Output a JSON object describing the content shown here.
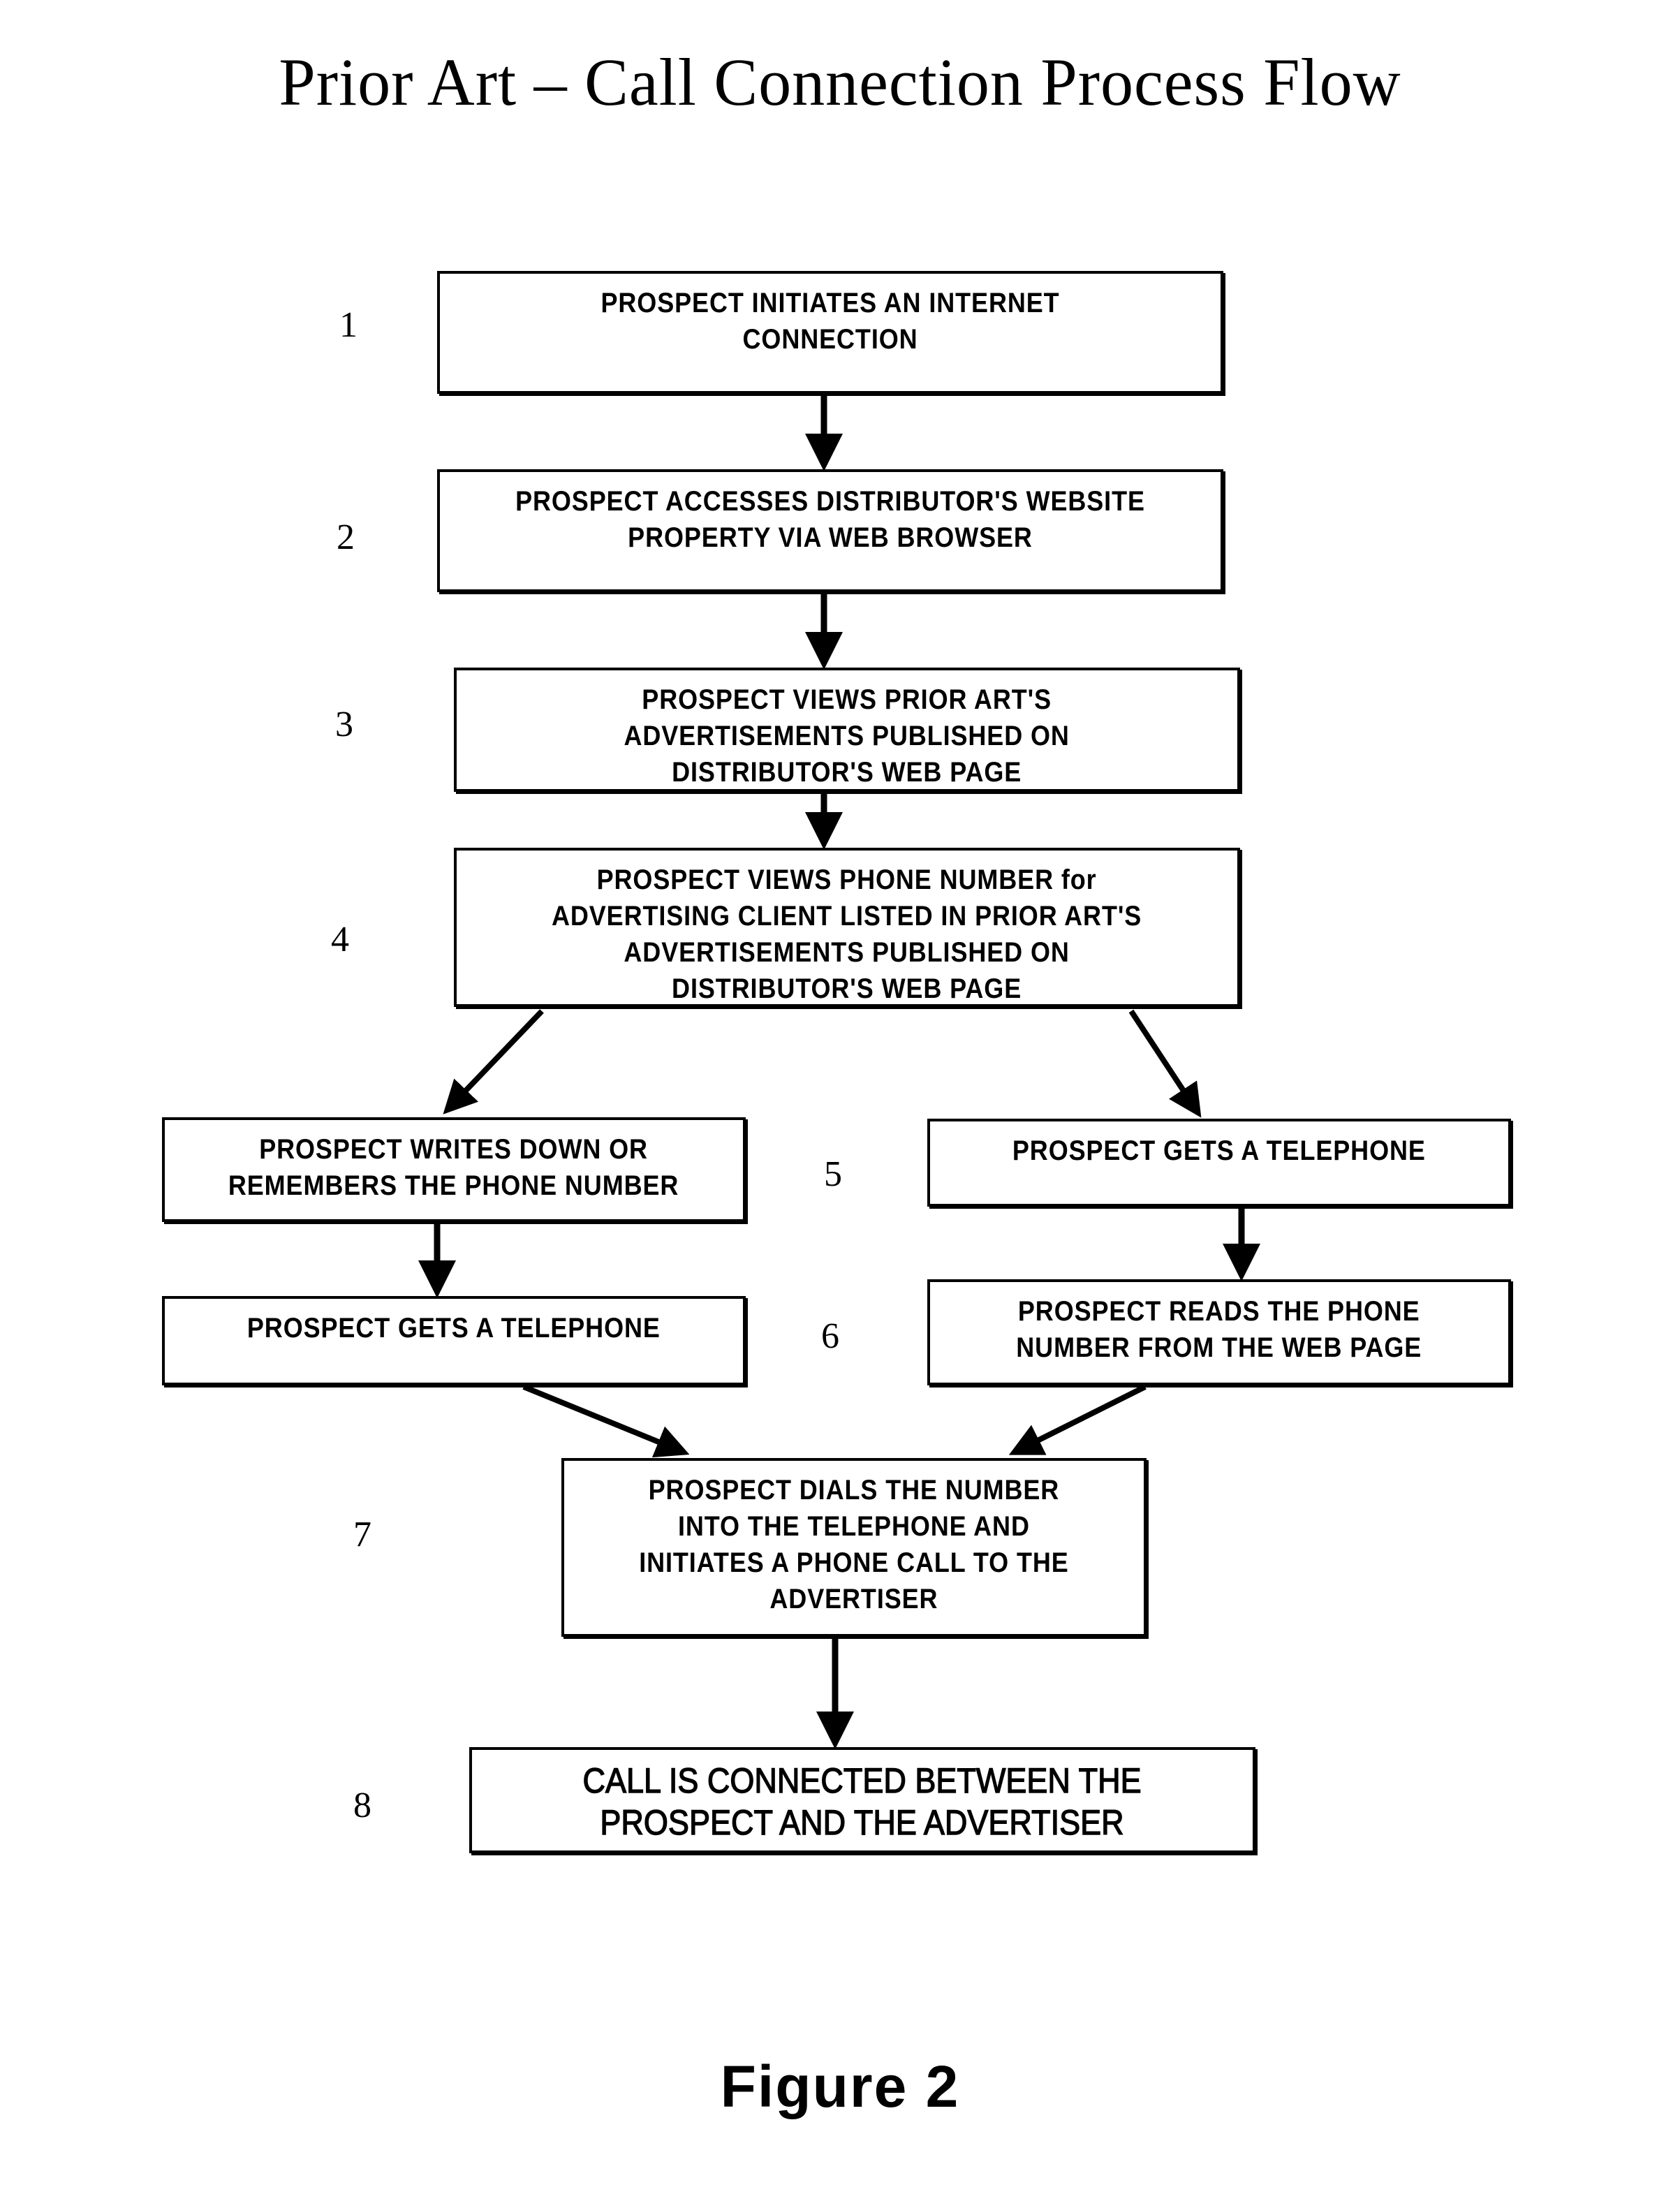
{
  "title": "Prior Art – Call Connection Process Flow",
  "figure_label": "Figure 2",
  "steps": [
    {
      "number": "1",
      "boxes": [
        "PROSPECT INITIATES AN INTERNET\nCONNECTION"
      ]
    },
    {
      "number": "2",
      "boxes": [
        "PROSPECT ACCESSES DISTRIBUTOR'S WEBSITE\nPROPERTY VIA WEB BROWSER"
      ]
    },
    {
      "number": "3",
      "boxes": [
        "PROSPECT VIEWS PRIOR ART'S\nADVERTISEMENTS PUBLISHED ON\nDISTRIBUTOR'S WEB PAGE"
      ]
    },
    {
      "number": "4",
      "boxes": [
        "PROSPECT VIEWS PHONE NUMBER for\nADVERTISING CLIENT LISTED IN PRIOR ART'S\nADVERTISEMENTS PUBLISHED ON\nDISTRIBUTOR'S WEB PAGE"
      ]
    },
    {
      "number": "5",
      "boxes": [
        "PROSPECT WRITES DOWN OR\nREMEMBERS THE PHONE NUMBER",
        "PROSPECT GETS A TELEPHONE"
      ]
    },
    {
      "number": "6",
      "boxes": [
        "PROSPECT GETS A TELEPHONE",
        "PROSPECT READS THE PHONE\nNUMBER FROM THE WEB PAGE"
      ]
    },
    {
      "number": "7",
      "boxes": [
        "PROSPECT DIALS THE NUMBER\nINTO THE TELEPHONE AND\nINITIATES A PHONE CALL TO THE\nADVERTISER"
      ]
    },
    {
      "number": "8",
      "boxes": [
        "CALL IS CONNECTED BETWEEN THE\nPROSPECT AND THE ADVERTISER"
      ]
    }
  ],
  "edges": [
    {
      "from": "step-1",
      "to": "step-2"
    },
    {
      "from": "step-2",
      "to": "step-3"
    },
    {
      "from": "step-3",
      "to": "step-4"
    },
    {
      "from": "step-4",
      "to": "step-5-left"
    },
    {
      "from": "step-4",
      "to": "step-5-right"
    },
    {
      "from": "step-5-left",
      "to": "step-6-left"
    },
    {
      "from": "step-5-right",
      "to": "step-6-right"
    },
    {
      "from": "step-6-left",
      "to": "step-7"
    },
    {
      "from": "step-6-right",
      "to": "step-7"
    },
    {
      "from": "step-7",
      "to": "step-8"
    }
  ]
}
